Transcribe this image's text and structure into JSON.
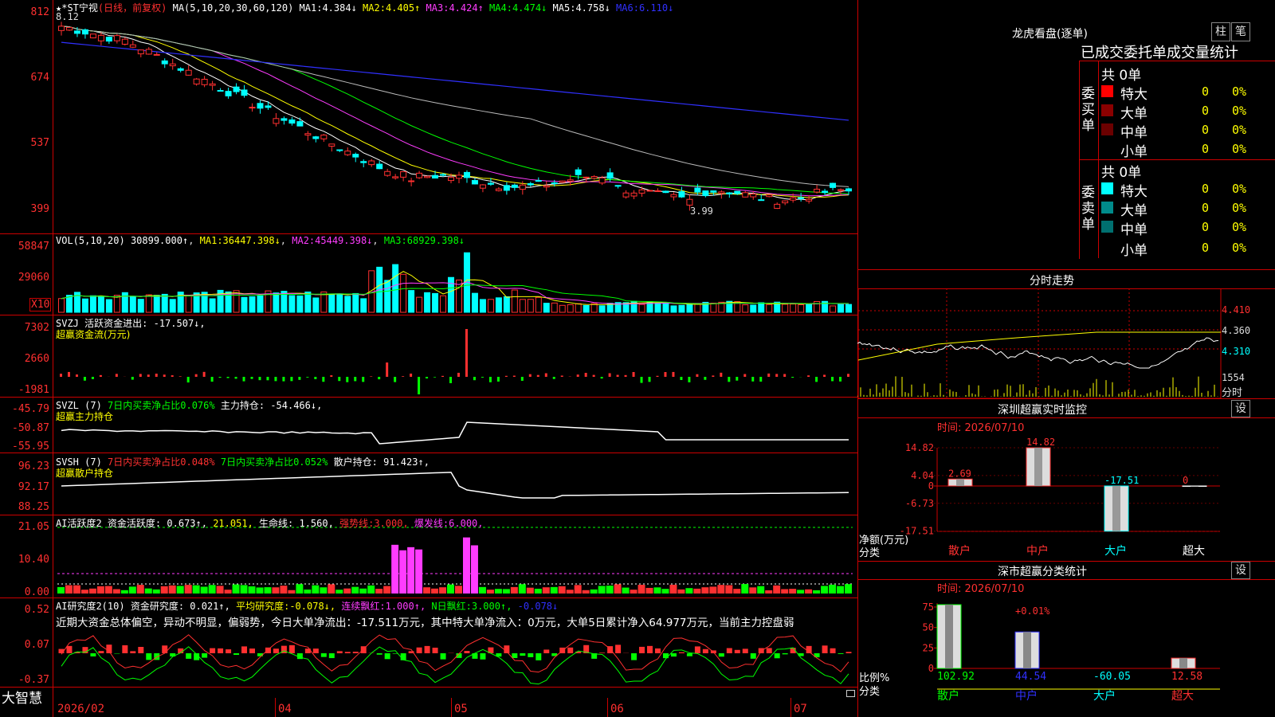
{
  "colors": {
    "up": "#ff3030",
    "down": "#00ffff",
    "ma1": "#ffffff",
    "ma2": "#ffff00",
    "ma3": "#ff3cff",
    "ma4": "#00ff00",
    "ma5": "#bbbbbb",
    "ma6": "#3030ff",
    "frame": "#cc0000"
  },
  "price_panel": {
    "title_prefix": "★*ST宁视",
    "title_period": "(日线，前复权)",
    "ma_header": "MA(5,10,20,30,60,120)",
    "ma_values": [
      {
        "label": "MA1:",
        "value": "4.384↓"
      },
      {
        "label": "MA2:",
        "value": "4.405↑"
      },
      {
        "label": "MA3:",
        "value": "4.424↑"
      },
      {
        "label": "MA4:",
        "value": "4.474↓"
      },
      {
        "label": "MA5:",
        "value": "4.758↓"
      },
      {
        "label": "MA6:",
        "value": "6.110↓"
      }
    ],
    "high_label": "8.12",
    "low_label": "3.99",
    "y_ticks": [
      "812",
      "674",
      "537",
      "399"
    ]
  },
  "vol_panel": {
    "header": "VOL(5,10,20)",
    "value": "30899.000↑",
    "mas": [
      {
        "label": "MA1:",
        "value": "36447.398↓"
      },
      {
        "label": "MA2:",
        "value": "45449.398↓"
      },
      {
        "label": "MA3:",
        "value": "68929.398↓"
      }
    ],
    "y_ticks": [
      "58847",
      "29060"
    ],
    "unit": "X10"
  },
  "svzj_panel": {
    "header": "SVZJ",
    "item": "活跃资金进出:",
    "value": "-17.507↓,",
    "subtitle": "超赢资金流(万元)",
    "y_ticks": [
      "7302",
      "2660",
      "-1981"
    ]
  },
  "svzl_panel": {
    "header": "SVZL (7)",
    "item": "7日内买卖净占比0.076%",
    "item2": "主力持仓:",
    "value": "-54.466↓,",
    "subtitle": "超赢主力持仓",
    "y_ticks": [
      "-45.79",
      "-50.87",
      "-55.95"
    ]
  },
  "svsh_panel": {
    "header": "SVSH (7)",
    "item": "7日内买卖净占比0.048%",
    "item2": "7日内买卖净占比0.052%",
    "item3": "散户持仓:",
    "value": "91.423↑,",
    "subtitle": "超赢散户持仓",
    "y_ticks": [
      "96.23",
      "92.17",
      "88.25"
    ]
  },
  "ai_active_panel": {
    "header": "AI活跃度2",
    "item": "资金活跃度:",
    "value": "0.673↑,",
    "v2": "21.051,",
    "item3": "生命线:",
    "v3": "1.560,",
    "item4": "强势线:",
    "v4": "3.000,",
    "item5": "爆发线:",
    "v5": "6.000,",
    "y_ticks": [
      "21.05",
      "10.40",
      "0.00"
    ]
  },
  "ai_research_panel": {
    "header": "AI研究度2(10)",
    "item": "资金研究度:",
    "value": "0.021↑,",
    "item2": "平均研究度:",
    "v2": "-0.078↓,",
    "item3": "连续飘红:",
    "v3": "1.000↑,",
    "item4": "N日飘红:",
    "v4": "3.000↑,",
    "v5": "-0.078↓",
    "note": "近期大资金总体偏空，异动不明显，偏弱势，今日大单净流出：-17.511万元，其中特大单净流入：0万元，大单5日累计净入64.977万元，当前主力控盘弱",
    "y_ticks": [
      "0.52",
      "0.07",
      "-0.37"
    ]
  },
  "x_axis": {
    "brand": "大智慧",
    "labels": [
      "2026/02",
      "04",
      "05",
      "06",
      "07"
    ]
  },
  "right": {
    "dragon_title": "龙虎看盘(逐单)",
    "btn_zhu": "柱",
    "btn_bi": "笔",
    "order_title": "已成交委托单成交量统计",
    "buy_side": "委买单",
    "sell_side": "委卖单",
    "buy_total": "共 0单",
    "sell_total": "共 0单",
    "buy_rows": [
      {
        "name": "特大",
        "n": "0",
        "pct": "0%",
        "color": "#ff0000"
      },
      {
        "name": "大单",
        "n": "0",
        "pct": "0%",
        "color": "#8b0000"
      },
      {
        "name": "中单",
        "n": "0",
        "pct": "0%",
        "color": "#6b0000"
      },
      {
        "name": "小单",
        "n": "0",
        "pct": "0%",
        "color": "#000000"
      }
    ],
    "sell_rows": [
      {
        "name": "特大",
        "n": "0",
        "pct": "0%",
        "color": "#00ffff"
      },
      {
        "name": "大单",
        "n": "0",
        "pct": "0%",
        "color": "#008b8b"
      },
      {
        "name": "中单",
        "n": "0",
        "pct": "0%",
        "color": "#007070"
      },
      {
        "name": "小单",
        "n": "0",
        "pct": "0%",
        "color": "#000000"
      }
    ],
    "intraday_title": "分时走势",
    "intraday_y": [
      "4.410",
      "4.360",
      "4.310"
    ],
    "intraday_vol": "1554",
    "intraday_unit": "分时",
    "monitor_title": "深圳超赢实时监控",
    "monitor_btn": "设",
    "monitor_time": "时间: 2026/07/10",
    "monitor_y": [
      "14.82",
      "4.04",
      "0",
      "-6.73",
      "-17.51"
    ],
    "monitor_ylabel": "净额(万元)",
    "monitor_xlabel": "分类",
    "classify_title": "深市超赢分类统计",
    "classify_btn": "设",
    "classify_time": "时间: 2026/07/10",
    "classify_y": [
      "75",
      "50",
      "25",
      "0"
    ],
    "classify_ylabel": "比例%",
    "classify_xlabel": "分类",
    "categories": [
      "散户",
      "中户",
      "大户",
      "超大"
    ]
  },
  "chart_data": [
    {
      "type": "bar",
      "title": "深圳超赢实时监控",
      "ylabel": "净额(万元)",
      "xlabel": "分类",
      "categories": [
        "散户",
        "中户",
        "大户",
        "超大"
      ],
      "values": [
        2.69,
        14.82,
        -17.51,
        0
      ],
      "ylim": [
        -17.51,
        14.82
      ],
      "value_labels": [
        "2.69",
        "14.82",
        "-17.51",
        "0"
      ]
    },
    {
      "type": "bar",
      "title": "深市超赢分类统计",
      "ylabel": "比例%",
      "xlabel": "分类",
      "categories": [
        "散户",
        "中户",
        "大户",
        "超大"
      ],
      "values": [
        102.92,
        44.54,
        -60.05,
        12.58
      ],
      "annotation": "+0.01%",
      "value_labels": [
        "102.92",
        "44.54",
        "-60.05",
        "12.58"
      ]
    }
  ]
}
